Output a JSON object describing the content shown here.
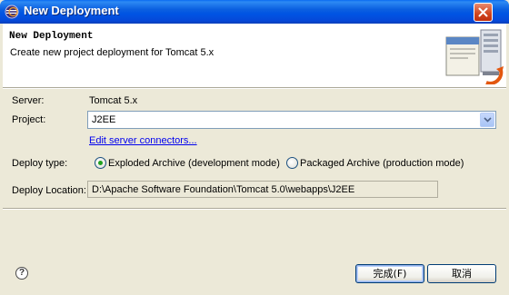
{
  "window": {
    "title": "New Deployment"
  },
  "banner": {
    "title": "New Deployment",
    "description": "Create new project deployment for Tomcat  5.x"
  },
  "form": {
    "server_label": "Server:",
    "server_value": "Tomcat  5.x",
    "project_label": "Project:",
    "project_value": "J2EE",
    "edit_link": "Edit server connectors...",
    "deploy_type_label": "Deploy type:",
    "option_exploded": "Exploded Archive (development mode)",
    "option_packaged": "Packaged Archive (production mode)",
    "selected_option": "exploded",
    "location_label": "Deploy Location:",
    "location_value": "D:\\Apache Software Foundation\\Tomcat 5.0\\webapps\\J2EE"
  },
  "buttons": {
    "finish": "完成(F)",
    "cancel": "取消"
  },
  "icons": {
    "title": "eclipse-icon",
    "close": "close-icon",
    "banner": "deploy-server-icon",
    "combo": "chevron-down-icon",
    "help": "help-icon"
  }
}
